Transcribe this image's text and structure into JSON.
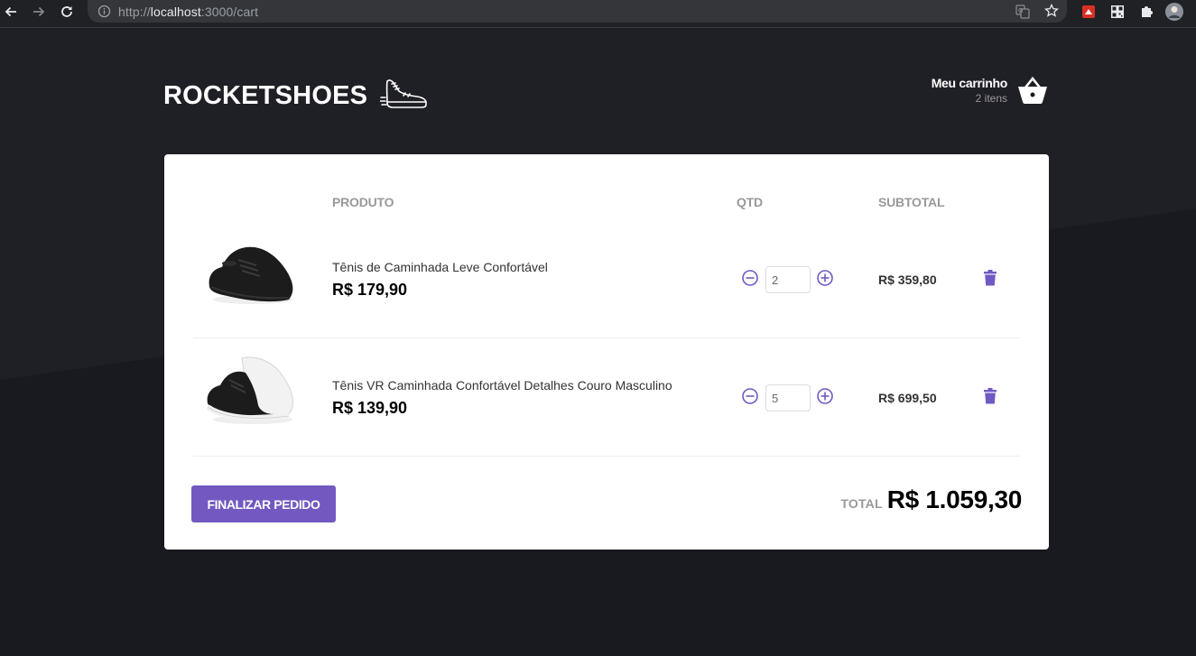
{
  "browser": {
    "url_prefix": "http://",
    "url_host": "localhost",
    "url_rest": ":3000/cart"
  },
  "header": {
    "logo": "ROCKETSHOES",
    "cart_title": "Meu carrinho",
    "cart_count": "2 itens"
  },
  "table": {
    "col_product": "PRODUTO",
    "col_qty": "QTD",
    "col_subtotal": "SUBTOTAL"
  },
  "items": [
    {
      "title": "Tênis de Caminhada Leve Confortável",
      "price": "R$ 179,90",
      "amount": "2",
      "subtotal": "R$ 359,80",
      "image_colors": {
        "upper": "#1c1c1c",
        "sole": "#222222"
      }
    },
    {
      "title": "Tênis VR Caminhada Confortável Detalhes Couro Masculino",
      "price": "R$ 139,90",
      "amount": "5",
      "subtotal": "R$ 699,50",
      "image_colors": {
        "upper": "#1c1c1c",
        "sole": "#f2f2f2"
      }
    }
  ],
  "footer": {
    "checkout_label": "Finalizar pedido",
    "total_label": "TOTAL",
    "total_value": "R$ 1.059,30"
  },
  "colors": {
    "background": "#191920",
    "accent": "#7159c1",
    "card": "#ffffff"
  },
  "icons": {
    "back": "arrow-left-icon",
    "forward": "arrow-right-icon",
    "reload": "reload-icon",
    "site_info": "info-icon",
    "translate": "translate-icon",
    "bookmark": "star-icon",
    "extensions": "puzzle-icon",
    "cart": "basket-icon",
    "remove": "minus-circle-icon",
    "add": "plus-circle-icon",
    "delete": "trash-icon",
    "logo": "sneaker-icon"
  }
}
